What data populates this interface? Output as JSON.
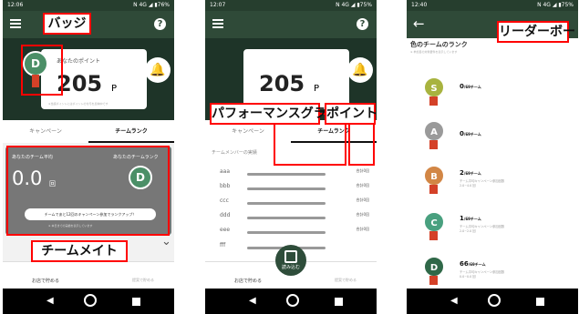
{
  "phone1": {
    "status_left": "12:06",
    "status_right": "N 4G ◢ ▮76%",
    "help": "?",
    "points_label": "あなたのポイント",
    "points": "205",
    "points_unit": "P",
    "card_note": "※当該ポイントにはポイントの付与を反映中です",
    "badge_letter": "D",
    "tabs": [
      "キャンペーン",
      "チームランク"
    ],
    "team_label": "あなたのチーム平均",
    "team_value": "0.0",
    "team_unit": "回",
    "team_rank_label": "あなたのチームランク",
    "ranking_message": "チームであと12回のキャンペーン参加でランクアップ！",
    "team_note": "※ 本日までの実績を表示しています",
    "nav_left": "お店で貯める",
    "nav_right": "提案で貯める",
    "down_chevron": "⌄"
  },
  "phone2": {
    "status_left": "12:07",
    "status_right": "N 4G ◢ ▮75%",
    "help": "?",
    "points": "205",
    "points_unit": "P",
    "tabs": [
      "キャンペーン",
      "チームランク"
    ],
    "list_header": "チームメンバーの実績",
    "members": [
      {
        "name": "aaa",
        "total": "合計0回"
      },
      {
        "name": "bbb",
        "total": "合計0回"
      },
      {
        "name": "ccc",
        "total": "合計0回"
      },
      {
        "name": "ddd",
        "total": "合計0回"
      },
      {
        "name": "eee",
        "total": "合計0回"
      },
      {
        "name": "fff",
        "total": ""
      }
    ],
    "scan_label": "読み込む",
    "nav_left": "お店で貯める",
    "nav_right": "提案で貯める"
  },
  "phone3": {
    "status_left": "12:40",
    "status_right": "N 4G ◢ ▮75%",
    "title": "色のチームのランク",
    "subtitle": "※ 参加目の対象要件を表示しています",
    "ranks": [
      {
        "letter": "S",
        "count": "0",
        "unit": "/69チーム",
        "desc": "",
        "color": "#a8b33f"
      },
      {
        "letter": "A",
        "count": "0",
        "unit": "/69チーム",
        "desc": "",
        "color": "#9a9a9a"
      },
      {
        "letter": "B",
        "count": "2",
        "unit": "/69チーム",
        "desc": "チーム平均キャンペーン参加回数 2.0~4.0 回",
        "color": "#d28645"
      },
      {
        "letter": "C",
        "count": "1",
        "unit": "/69チーム",
        "desc": "チーム平均キャンペーン参加回数 2.0~2.0 回",
        "color": "#49a07f"
      },
      {
        "letter": "D",
        "count": "66",
        "unit": "/69チーム",
        "desc": "チーム平均キャンペーン参加回数 0.0~0.0 回",
        "color": "#2f6848"
      }
    ]
  },
  "annotations": {
    "badge": "バッジ",
    "team_mate": "チームメイト",
    "performance": "パフォーマンスグラフ",
    "points": "ポイント",
    "leaderboard": "リーダーボード"
  }
}
